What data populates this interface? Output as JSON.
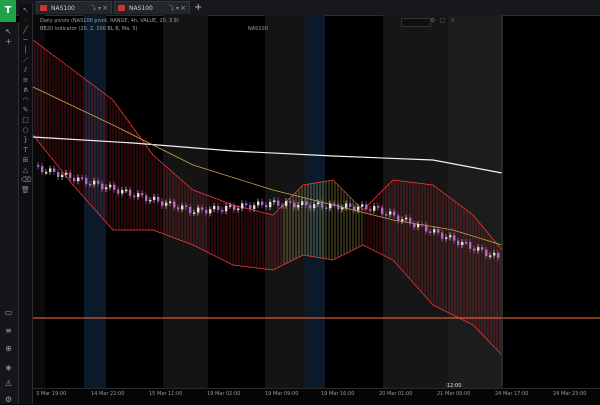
{
  "tabs": [
    {
      "label": "NAS100",
      "control": "⤵ ▾"
    },
    {
      "label": "NAS100",
      "control": "⤵ ▾"
    }
  ],
  "chart": {
    "legend_line1": "Daily pivots (NAS100 pivot, RANGE, 4h, VALUE, 20, 3.9)",
    "legend_line2": "BB20 indicator (20, 2, 100 BL B, Ma. 5)",
    "legend_tag": "NAS100"
  },
  "xaxis_labels": [
    "3 Mar 19:00",
    "14 Mar 22:00",
    "15 Mar 11:00",
    "19 Mar 02:00",
    "19 Mar 09:00",
    "19 Mar 16:00",
    "20 Mar 01:00",
    "21 Mar 09:00",
    "22 Mar 09:00",
    "24 Mar 17:00",
    "24 Mar 23:00"
  ],
  "xaxis_cursor": "12:00",
  "colors": {
    "up": "#e0e0e0",
    "down": "#b069c8",
    "band_down": "#c0272d",
    "band_up": "#d9c35a",
    "long_ma": "#f2f2f2",
    "mid_ma": "#caa24a",
    "hline": "#ff6a3d"
  }
}
